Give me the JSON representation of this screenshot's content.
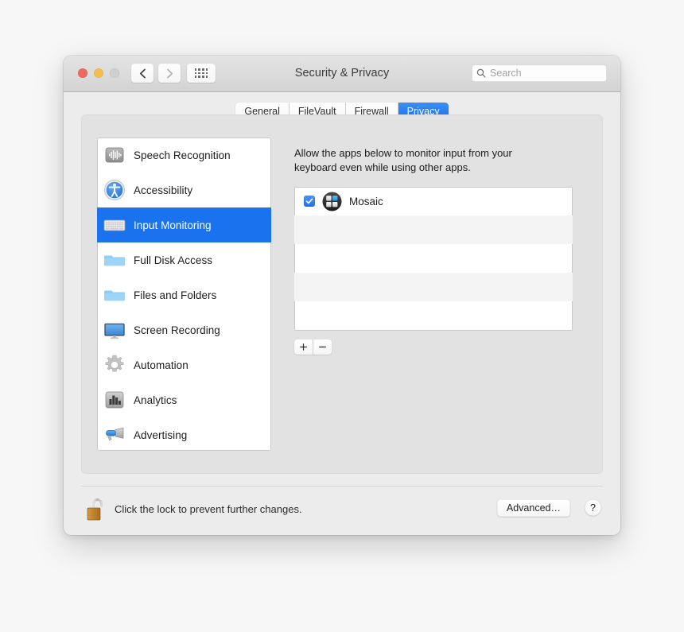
{
  "window": {
    "title": "Security & Privacy",
    "traffic_lights": [
      "close",
      "minimize",
      "zoom"
    ],
    "nav": {
      "back_label": "Back",
      "forward_label": "Forward",
      "show_all_label": "Show All"
    }
  },
  "search": {
    "placeholder": "Search",
    "value": ""
  },
  "tabs": [
    {
      "label": "General",
      "active": false
    },
    {
      "label": "FileVault",
      "active": false
    },
    {
      "label": "Firewall",
      "active": false
    },
    {
      "label": "Privacy",
      "active": true
    }
  ],
  "sidebar": {
    "items": [
      {
        "label": "Speech Recognition",
        "icon": "waveform-icon",
        "selected": false
      },
      {
        "label": "Accessibility",
        "icon": "accessibility-icon",
        "selected": false
      },
      {
        "label": "Input Monitoring",
        "icon": "keyboard-icon",
        "selected": true
      },
      {
        "label": "Full Disk Access",
        "icon": "folder-icon",
        "selected": false
      },
      {
        "label": "Files and Folders",
        "icon": "folder-icon",
        "selected": false
      },
      {
        "label": "Screen Recording",
        "icon": "display-icon",
        "selected": false
      },
      {
        "label": "Automation",
        "icon": "gear-icon",
        "selected": false
      },
      {
        "label": "Analytics",
        "icon": "bar-chart-icon",
        "selected": false
      },
      {
        "label": "Advertising",
        "icon": "megaphone-icon",
        "selected": false
      }
    ]
  },
  "content": {
    "description": "Allow the apps below to monitor input from your keyboard even while using other apps.",
    "apps": [
      {
        "name": "Mosaic",
        "checked": true,
        "icon": "mosaic-app-icon"
      }
    ],
    "empty_row_count": 4,
    "add_label": "+",
    "remove_label": "−"
  },
  "footer": {
    "lock_icon": "unlocked-padlock-icon",
    "lock_text": "Click the lock to prevent further changes.",
    "advanced_label": "Advanced…",
    "help_label": "?"
  },
  "colors": {
    "accent_blue": "#1a72ee",
    "window_bg": "#ececec",
    "panel_bg": "#e2e2e2",
    "list_bg": "#ffffff",
    "stripe": "#f4f4f4",
    "lock_gold": "#c98b2e",
    "desktop_bg": "#f7f7f7"
  }
}
